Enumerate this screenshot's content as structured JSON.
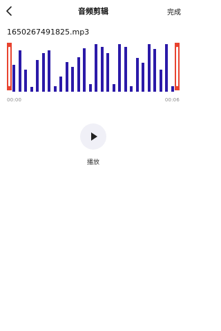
{
  "header": {
    "title": "音频剪辑",
    "done_label": "完成",
    "back_icon": "chevron-left-icon"
  },
  "file": {
    "name": "1650267491825.mp3"
  },
  "waveform": {
    "bar_color": "#2b1aa8",
    "handle_color": "#e8432f",
    "levels": [
      0.55,
      0.85,
      0.45,
      0.1,
      0.65,
      0.8,
      0.85,
      0.12,
      0.32,
      0.62,
      0.52,
      0.72,
      0.9,
      0.15,
      0.99,
      0.93,
      0.8,
      0.15,
      0.99,
      0.93,
      0.12,
      0.7,
      0.6,
      0.98,
      0.88,
      0.45,
      0.98,
      0.12
    ]
  },
  "timeline": {
    "start": "00:00",
    "end": "00:06"
  },
  "player": {
    "play_label": "播放",
    "play_icon": "play-icon"
  }
}
